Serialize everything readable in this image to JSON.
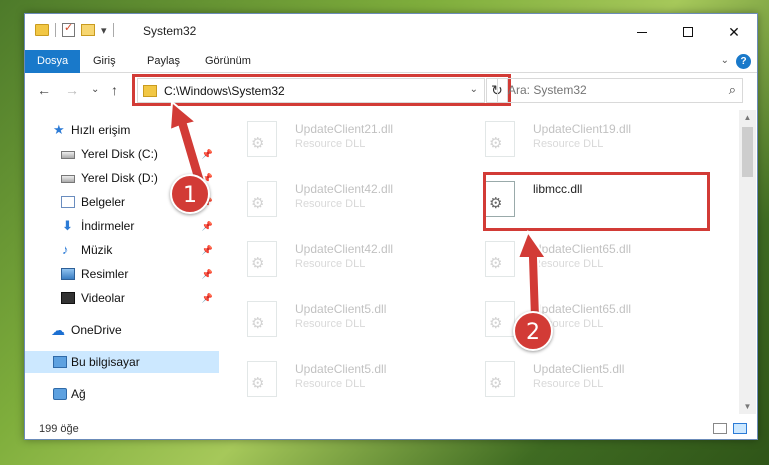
{
  "window": {
    "title": "System32"
  },
  "quick_access_toolbar": {
    "customize_glyph": "▾"
  },
  "ribbon": {
    "tabs": [
      {
        "label": "Dosya",
        "active": true
      },
      {
        "label": "Giriş"
      },
      {
        "label": "Paylaş"
      },
      {
        "label": "Görünüm"
      }
    ],
    "help_label": "?"
  },
  "navigation": {
    "back": "←",
    "forward": "→",
    "recent": "⌄",
    "up": "↑",
    "address": "C:\\Windows\\System32",
    "refresh": "↻",
    "search_placeholder": "Ara: System32"
  },
  "sidebar": {
    "items": [
      {
        "label": "Hızlı erişim",
        "icon": "star-icon"
      },
      {
        "label": "Yerel Disk (C:)",
        "icon": "disk-icon",
        "pinned": true
      },
      {
        "label": "Yerel Disk (D:)",
        "icon": "disk-icon",
        "pinned": true
      },
      {
        "label": "Belgeler",
        "icon": "documents-icon",
        "pinned": true
      },
      {
        "label": "İndirmeler",
        "icon": "download-icon",
        "pinned": true
      },
      {
        "label": "Müzik",
        "icon": "music-icon",
        "pinned": true
      },
      {
        "label": "Resimler",
        "icon": "pictures-icon",
        "pinned": true
      },
      {
        "label": "Videolar",
        "icon": "videos-icon",
        "pinned": true
      },
      {
        "label": "OneDrive",
        "icon": "cloud-icon"
      },
      {
        "label": "Bu bilgisayar",
        "icon": "computer-icon",
        "selected": true
      },
      {
        "label": "Ağ",
        "icon": "network-icon"
      }
    ]
  },
  "files": [
    {
      "name": "UpdateClient21.dll",
      "desc": "Resource DLL"
    },
    {
      "name": "UpdateClient19.dll",
      "desc": "Resource DLL"
    },
    {
      "name": "UpdateClient42.dll",
      "desc": "Resource DLL"
    },
    {
      "name": "libmcc.dll",
      "desc": ""
    },
    {
      "name": "UpdateClient42.dll",
      "desc": "Resource DLL"
    },
    {
      "name": "UpdateClient65.dll",
      "desc": "Resource DLL"
    },
    {
      "name": "UpdateClient5.dll",
      "desc": "Resource DLL"
    },
    {
      "name": "UpdateClient65.dll",
      "desc": "Resource DLL"
    },
    {
      "name": "UpdateClient5.dll",
      "desc": "Resource DLL"
    },
    {
      "name": "UpdateClient5.dll",
      "desc": "Resource DLL"
    }
  ],
  "status": {
    "count": "199 öğe"
  },
  "badges": {
    "one": "1",
    "two": "2"
  },
  "colors": {
    "accent": "#1979ca",
    "highlight": "#d23b36",
    "selection": "#cce8ff"
  }
}
